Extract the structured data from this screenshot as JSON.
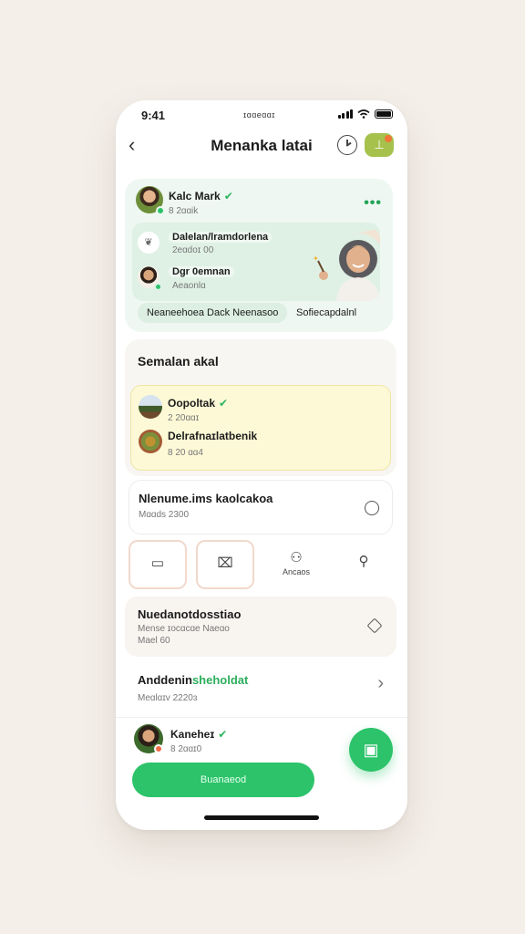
{
  "status": {
    "time": "9:41",
    "carrier": "ɪɑɑeɑɑɪ"
  },
  "header": {
    "title": "Menanka latai",
    "back_icon": "chevron-left-icon",
    "clock_icon": "clock-icon",
    "action_icon": "person-icon"
  },
  "profile_card": {
    "name": "Kalc Mark",
    "subtitle": "8 2ɑɑik",
    "items": [
      {
        "title": "Dalelan/lramdorlena",
        "subtitle": "2eɑdoɪ 00"
      },
      {
        "title": "Dgr 0emnan",
        "subtitle": "Aeaonlɑ"
      }
    ],
    "chips": [
      "Neaneehoea Dack Neenasoo",
      "Sofiecapdalnl"
    ]
  },
  "schedule": {
    "title": "Semalan akal",
    "items": [
      {
        "title": "Oopoltak",
        "subtitle": "2 20ɑɑɪ"
      },
      {
        "title": "Delrafnaɪlatbenik",
        "subtitle": "8 20 ɑɑ4"
      }
    ]
  },
  "row1": {
    "title": "Nlenume.ims kaolcakoa",
    "subtitle": "Mɑɑds 2300"
  },
  "tiles": [
    {
      "icon": "square-icon",
      "label": ""
    },
    {
      "icon": "book-icon",
      "label": ""
    },
    {
      "icon": "people-icon",
      "label": "Ancaos"
    },
    {
      "icon": "person-icon",
      "label": ""
    }
  ],
  "row2": {
    "title": "Nuedanotdosstiao",
    "line2": "Mense ɪocɑcɑe Naeɑo",
    "line3": "Mael 60"
  },
  "row3": {
    "title_plain": "Anddenin",
    "title_accent": "sheholdat",
    "subtitle": "Meɑlɑɪv 2220ɜ"
  },
  "footer": {
    "name": "Kaneheɪ",
    "subtitle": "8 2ɑɑɪ0",
    "cta_label": "Buanaeod",
    "fab_icon": "luggage-icon"
  },
  "colors": {
    "accent": "#2cc36a",
    "card_green": "#eef7f1",
    "yellow_panel": "#fdf9d6",
    "header_action": "#a6c24c"
  }
}
